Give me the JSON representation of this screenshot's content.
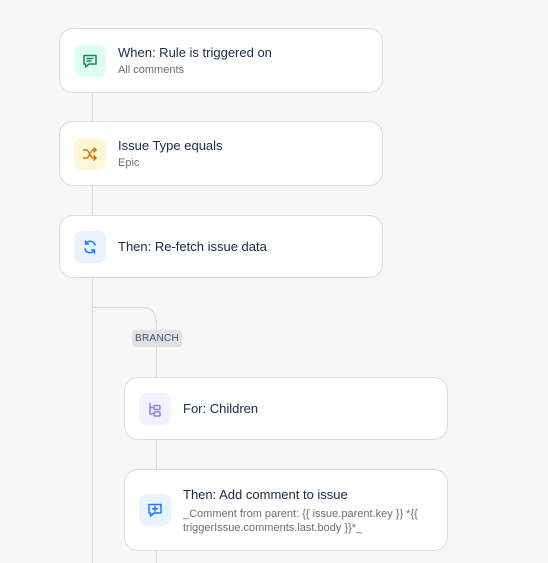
{
  "colors": {
    "trigger_icon_bg": "#dcfff1",
    "trigger_icon_fg": "#1f845a",
    "condition_icon_bg": "#fff7d6",
    "condition_icon_fg": "#d97008",
    "action_icon_bg": "#e9f2ff",
    "action_icon_fg": "#1d7afc",
    "branch_icon_bg": "#f3f0ff",
    "branch_icon_fg": "#8f7ee7",
    "connector": "#d6d6d6"
  },
  "rule_steps": [
    {
      "title": "When: Rule is triggered on",
      "subtitle": "All comments",
      "icon": "comment-icon"
    },
    {
      "title": "Issue Type equals",
      "subtitle": "Epic",
      "icon": "shuffle-icon"
    },
    {
      "title": "Then: Re-fetch issue data",
      "icon": "refresh-icon"
    }
  ],
  "branch": {
    "badge": "BRANCH",
    "steps": [
      {
        "title": "For: Children",
        "icon": "hierarchy-icon"
      },
      {
        "title": "Then: Add comment to issue",
        "subtitle_line1": "_Comment from parent: {{ issue.parent.key }} *{{",
        "subtitle_line2": "triggerIssue.comments.last.body }}*_",
        "icon": "add-comment-icon"
      }
    ]
  }
}
